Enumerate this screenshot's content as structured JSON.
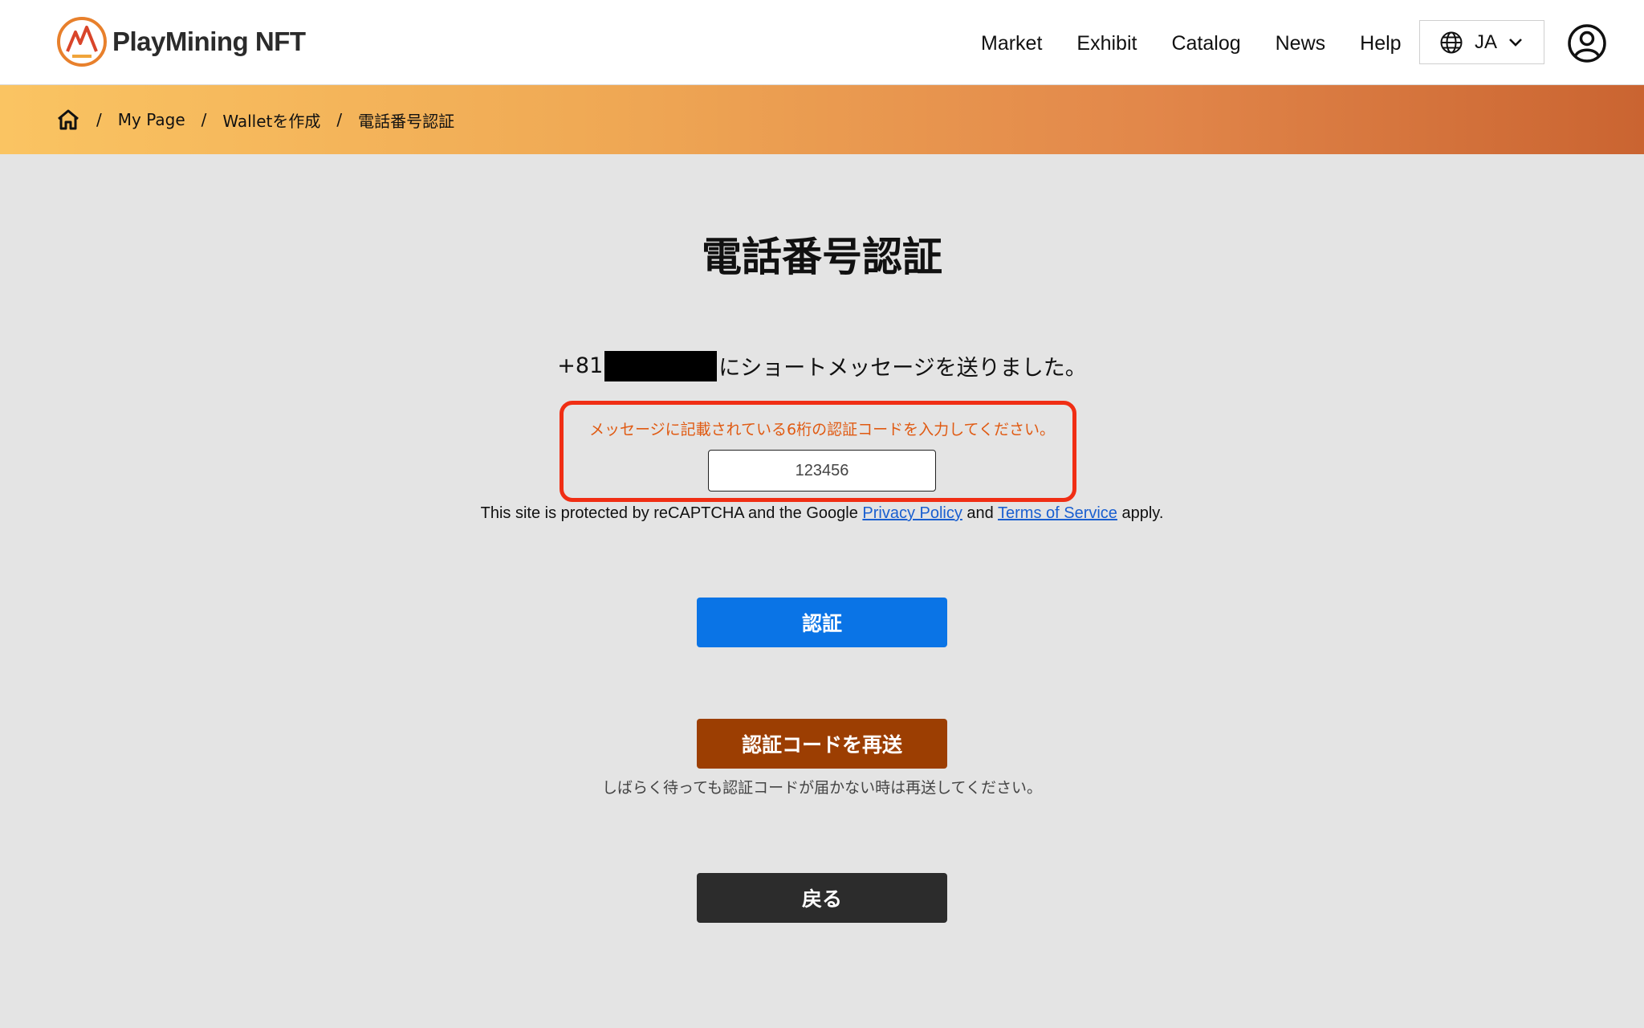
{
  "header": {
    "logo_text": "PlayMining NFT",
    "nav": [
      "Market",
      "Exhibit",
      "Catalog",
      "News",
      "Help"
    ],
    "language": "JA"
  },
  "breadcrumb": {
    "items": [
      "My Page",
      "Walletを作成",
      "電話番号認証"
    ],
    "separator": "/"
  },
  "main": {
    "title": "電話番号認証",
    "phone_prefix": "+81",
    "sent_message": "にショートメッセージを送りました。",
    "instruction": "メッセージに記載されている6桁の認証コードを入力してください。",
    "code_value": "123456",
    "recaptcha": {
      "before": "This site is protected by reCAPTCHA and the Google ",
      "privacy_link": "Privacy Policy",
      "middle": " and ",
      "terms_link": "Terms of Service",
      "after": " apply."
    },
    "verify_button": "認証",
    "resend_button": "認証コードを再送",
    "resend_note": "しばらく待っても認証コードが届かない時は再送してください。",
    "back_button": "戻る"
  },
  "colors": {
    "verify": "#0a74e6",
    "resend": "#9c3e02",
    "back": "#2c2c2c",
    "highlight": "#f02e14",
    "instruction": "#e05a12"
  }
}
